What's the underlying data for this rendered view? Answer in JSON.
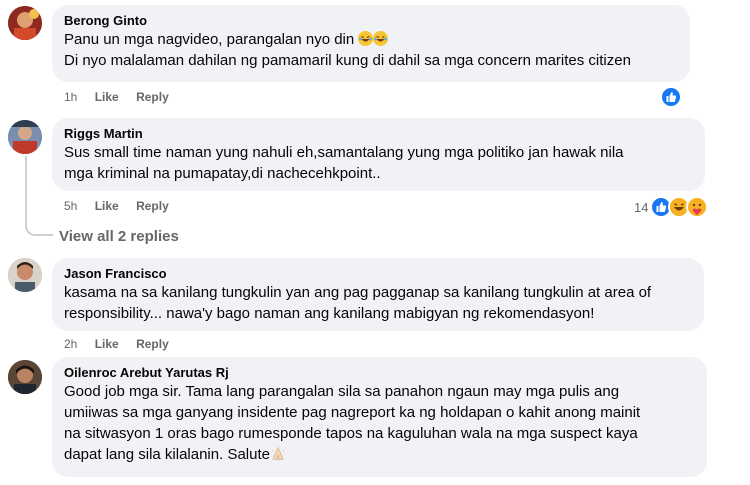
{
  "comments": [
    {
      "author": "Berong Ginto",
      "lines": [
        "Panu un mga nagvideo, parangalan nyo din",
        "Di nyo malalaman dahilan ng pamamaril kung di dahil sa mga concern marites citizen"
      ],
      "time": "1h",
      "like": "Like",
      "reply": "Reply",
      "avatar_color": "#b33a2a"
    },
    {
      "author": "Riggs Martin",
      "lines": [
        "Sus small time naman yung nahuli eh,samantalang yung mga politiko jan hawak nila",
        "mga kriminal na pumapatay,di nachecehkpoint.."
      ],
      "time": "5h",
      "like": "Like",
      "reply": "Reply",
      "reaction_count": "14",
      "avatar_color": "#5a6f8f"
    },
    {
      "author": "Jason Francisco",
      "lines": [
        "kasama na sa kanilang tungkulin yan ang pag pagganap sa kanilang tungkulin at area of",
        "responsibility... nawa'y bago naman ang kanilang mabigyan ng rekomendasyon!"
      ],
      "time": "2h",
      "like": "Like",
      "reply": "Reply",
      "avatar_color": "#c98a6b"
    },
    {
      "author": "Oilenroc Arebut Yarutas Rj",
      "lines": [
        "Good job mga sir. Tama lang parangalan sila sa panahon ngaun may mga pulis ang",
        "umiiwas sa mga ganyang insidente pag nagreport ka ng holdapan o kahit anong mainit",
        "na sitwasyon 1 oras bago rumesponde tapos na kaguluhan wala na mga suspect kaya",
        "dapat lang sila kilalanin. Salute"
      ],
      "avatar_color": "#3b2a22"
    }
  ],
  "view_replies": "View all 2 replies",
  "colors": {
    "bubble": "#f0f2f5",
    "meta": "#65676b",
    "like_blue": "#1877f2"
  }
}
